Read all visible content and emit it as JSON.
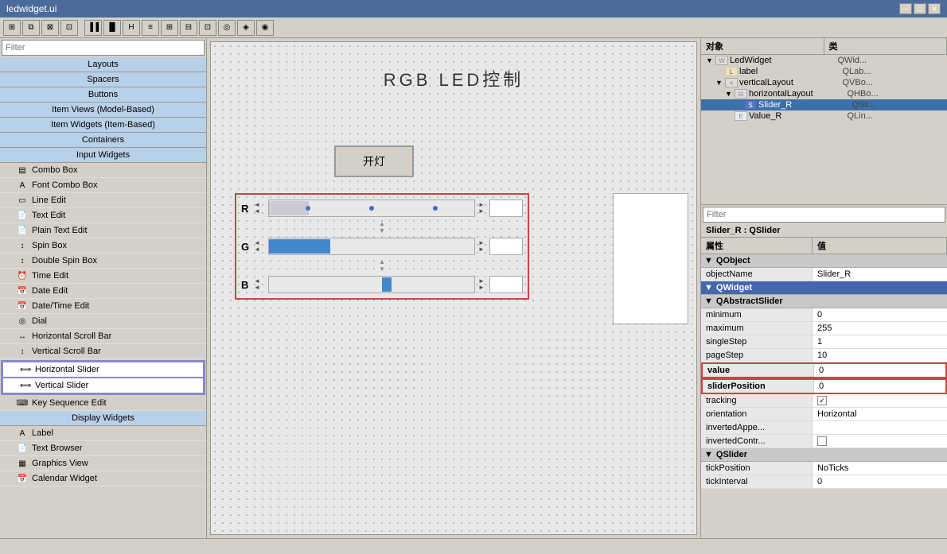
{
  "titlebar": {
    "title": "ledwidget.ui",
    "close": "✕",
    "minimize": "─",
    "maximize": "□"
  },
  "toolbar": {
    "buttons": [
      "⊞",
      "⊟",
      "◈",
      "◉",
      "⊡",
      "⊞",
      "▐",
      "▌",
      "⊟",
      "≡",
      "≡",
      "⊞",
      "⊟",
      "⊡",
      "◎",
      "⊟"
    ]
  },
  "left_panel": {
    "filter_placeholder": "Filter",
    "categories": [
      {
        "id": "layouts",
        "label": "Layouts",
        "type": "section"
      },
      {
        "id": "spacers",
        "label": "Spacers",
        "type": "section"
      },
      {
        "id": "buttons",
        "label": "Buttons",
        "type": "section"
      },
      {
        "id": "item-views",
        "label": "Item Views (Model-Based)",
        "type": "section"
      },
      {
        "id": "item-widgets",
        "label": "Item Widgets (Item-Based)",
        "type": "section"
      },
      {
        "id": "containers",
        "label": "Containers",
        "type": "section"
      },
      {
        "id": "input-widgets",
        "label": "Input Widgets",
        "type": "section"
      }
    ],
    "input_widgets": [
      {
        "id": "combo-box",
        "label": "Combo Box",
        "icon": "▤"
      },
      {
        "id": "font-combo-box",
        "label": "Font Combo Box",
        "icon": "A"
      },
      {
        "id": "line-edit",
        "label": "Line Edit",
        "icon": "▭"
      },
      {
        "id": "text-edit",
        "label": "Text Edit",
        "icon": "📄"
      },
      {
        "id": "plain-text-edit",
        "label": "Plain Text Edit",
        "icon": "📄"
      },
      {
        "id": "spin-box",
        "label": "Spin Box",
        "icon": "↕"
      },
      {
        "id": "double-spin-box",
        "label": "Double Spin Box",
        "icon": "↕"
      },
      {
        "id": "time-edit",
        "label": "Time Edit",
        "icon": "⏰"
      },
      {
        "id": "date-edit",
        "label": "Date Edit",
        "icon": "📅"
      },
      {
        "id": "datetime-edit",
        "label": "Date/Time Edit",
        "icon": "📅"
      },
      {
        "id": "dial",
        "label": "Dial",
        "icon": "◎"
      },
      {
        "id": "horiz-scroll",
        "label": "Horizontal Scroll Bar",
        "icon": "↔"
      },
      {
        "id": "vert-scroll",
        "label": "Vertical Scroll Bar",
        "icon": "↕"
      },
      {
        "id": "horiz-slider",
        "label": "Horizontal Slider",
        "icon": "⟺",
        "highlighted": true
      },
      {
        "id": "vert-slider",
        "label": "Vertical Slider",
        "icon": "⟺",
        "highlighted": true
      },
      {
        "id": "key-sequence",
        "label": "Key Sequence Edit",
        "icon": "⌨"
      }
    ],
    "display_widgets_header": "Display Widgets",
    "display_widgets": [
      {
        "id": "label",
        "label": "Label",
        "icon": "A"
      },
      {
        "id": "text-browser",
        "label": "Text Browser",
        "icon": "📄"
      },
      {
        "id": "graphics-view",
        "label": "Graphics View",
        "icon": "▦"
      },
      {
        "id": "calendar-widget",
        "label": "Calendar Widget",
        "icon": "📅"
      }
    ]
  },
  "canvas": {
    "title": "RGB  LED控制",
    "button_label": "开灯",
    "sliders": [
      {
        "id": "slider-r",
        "label": "R",
        "value": 0,
        "max": 255
      },
      {
        "id": "slider-g",
        "label": "G",
        "value": 80,
        "max": 255
      },
      {
        "id": "slider-b",
        "label": "B",
        "value": 160,
        "max": 255
      }
    ]
  },
  "right_panel": {
    "object_tree": {
      "header_col1": "对象",
      "header_col2": "类",
      "items": [
        {
          "id": "ledwidget",
          "label": "LedWidget",
          "class": "QWid...",
          "level": 0,
          "expanded": true,
          "icon": "W"
        },
        {
          "id": "label",
          "label": "label",
          "class": "QLab...",
          "level": 1,
          "icon": "L"
        },
        {
          "id": "verticallayout",
          "label": "verticalLayout",
          "class": "QVBo...",
          "level": 1,
          "expanded": true,
          "icon": "V"
        },
        {
          "id": "horizontallayout",
          "label": "horizontalLayout",
          "class": "QHBo...",
          "level": 2,
          "expanded": true,
          "icon": "H"
        },
        {
          "id": "slider-r",
          "label": "Slider_R",
          "class": "QSli...",
          "level": 3,
          "selected": true,
          "icon": "S"
        },
        {
          "id": "value-r",
          "label": "Value_R",
          "class": "QLin...",
          "level": 2,
          "icon": "E"
        }
      ]
    },
    "props_panel": {
      "filter_placeholder": "Filter",
      "subtitle": "Slider_R : QSlider",
      "header_col1": "属性",
      "header_col2": "值",
      "sections": [
        {
          "id": "qobject",
          "label": "QObject",
          "properties": [
            {
              "name": "objectName",
              "value": "Slider_R",
              "bold": false,
              "value_highlight": false
            }
          ]
        },
        {
          "id": "qwidget",
          "label": "QWidget",
          "collapsed": false,
          "blue_bg": true
        },
        {
          "id": "qabstractslider",
          "label": "QAbstractSlider",
          "properties": [
            {
              "name": "minimum",
              "value": "0",
              "bold": false
            },
            {
              "name": "maximum",
              "value": "255",
              "bold": false
            },
            {
              "name": "singleStep",
              "value": "1",
              "bold": false
            },
            {
              "name": "pageStep",
              "value": "10",
              "bold": false
            },
            {
              "name": "value",
              "value": "0",
              "bold": true,
              "highlight_red": true
            },
            {
              "name": "sliderPosition",
              "value": "0",
              "bold": true,
              "highlight_red": true
            },
            {
              "name": "tracking",
              "value": "checkbox_checked",
              "bold": false
            },
            {
              "name": "orientation",
              "value": "Horizontal",
              "bold": false
            },
            {
              "name": "invertedAppe...",
              "value": "",
              "bold": false
            },
            {
              "name": "invertedContr...",
              "value": "checkbox_unchecked",
              "bold": false
            }
          ]
        },
        {
          "id": "qslider",
          "label": "QSlider",
          "properties": [
            {
              "name": "tickPosition",
              "value": "NoTicks",
              "bold": false
            },
            {
              "name": "tickInterval",
              "value": "0",
              "bold": false
            }
          ]
        }
      ]
    }
  }
}
